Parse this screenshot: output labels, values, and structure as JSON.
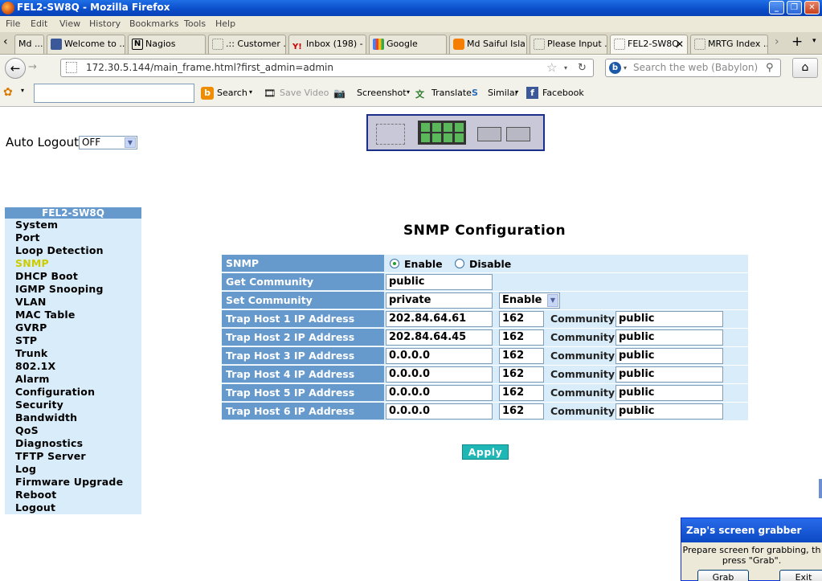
{
  "window": {
    "title": "FEL2-SW8Q - Mozilla Firefox"
  },
  "menu": {
    "items": [
      "File",
      "Edit",
      "View",
      "History",
      "Bookmarks",
      "Tools",
      "Help"
    ]
  },
  "tabs": [
    {
      "label": "Md ..."
    },
    {
      "label": "Welcome to ..."
    },
    {
      "label": "Nagios"
    },
    {
      "label": ".:: Customer ..."
    },
    {
      "label": "Inbox (198) - ..."
    },
    {
      "label": "Google"
    },
    {
      "label": "Md Saiful Isla..."
    },
    {
      "label": "Please Input ..."
    },
    {
      "label": "FEL2-SW8Q"
    },
    {
      "label": "MRTG Index ..."
    }
  ],
  "nav": {
    "url": "172.30.5.144/main_frame.html?first_admin=admin",
    "search_placeholder": "Search the web (Babylon)"
  },
  "toolbar": {
    "search": "Search",
    "save_video": "Save Video",
    "screenshot": "Screenshot",
    "translate": "Translate",
    "similar": "Similar",
    "facebook": "Facebook"
  },
  "page": {
    "auto_logout_label": "Auto Logout",
    "auto_logout_value": "OFF",
    "sidebar_title": "FEL2-SW8Q",
    "sidebar_items": [
      "System",
      "Port",
      "Loop Detection",
      "SNMP",
      "DHCP Boot",
      "IGMP Snooping",
      "VLAN",
      "MAC Table",
      "GVRP",
      "STP",
      "Trunk",
      "802.1X",
      "Alarm",
      "Configuration",
      "Security",
      "Bandwidth",
      "QoS",
      "Diagnostics",
      "TFTP Server",
      "Log",
      "Firmware Upgrade",
      "Reboot",
      "Logout"
    ],
    "active_item": "SNMP",
    "heading": "SNMP Configuration",
    "snmp": {
      "label": "SNMP",
      "enable": "Enable",
      "disable": "Disable",
      "selected": "Enable"
    },
    "get_community": {
      "label": "Get Community",
      "value": "public"
    },
    "set_community": {
      "label": "Set Community",
      "value": "private",
      "mode": "Enable"
    },
    "community_label": "Community",
    "trap_hosts": [
      {
        "label": "Trap Host 1 IP Address",
        "ip": "202.84.64.61",
        "port": "162",
        "community": "public"
      },
      {
        "label": "Trap Host 2 IP Address",
        "ip": "202.84.64.45",
        "port": "162",
        "community": "public"
      },
      {
        "label": "Trap Host 3 IP Address",
        "ip": "0.0.0.0",
        "port": "162",
        "community": "public"
      },
      {
        "label": "Trap Host 4 IP Address",
        "ip": "0.0.0.0",
        "port": "162",
        "community": "public"
      },
      {
        "label": "Trap Host 5 IP Address",
        "ip": "0.0.0.0",
        "port": "162",
        "community": "public"
      },
      {
        "label": "Trap Host 6 IP Address",
        "ip": "0.0.0.0",
        "port": "162",
        "community": "public"
      }
    ],
    "apply": "Apply"
  },
  "zap": {
    "title": "Zap's screen grabber",
    "line1": "Prepare screen for grabbing, th",
    "line2": "press \"Grab\".",
    "grab": "Grab",
    "exit": "Exit"
  }
}
